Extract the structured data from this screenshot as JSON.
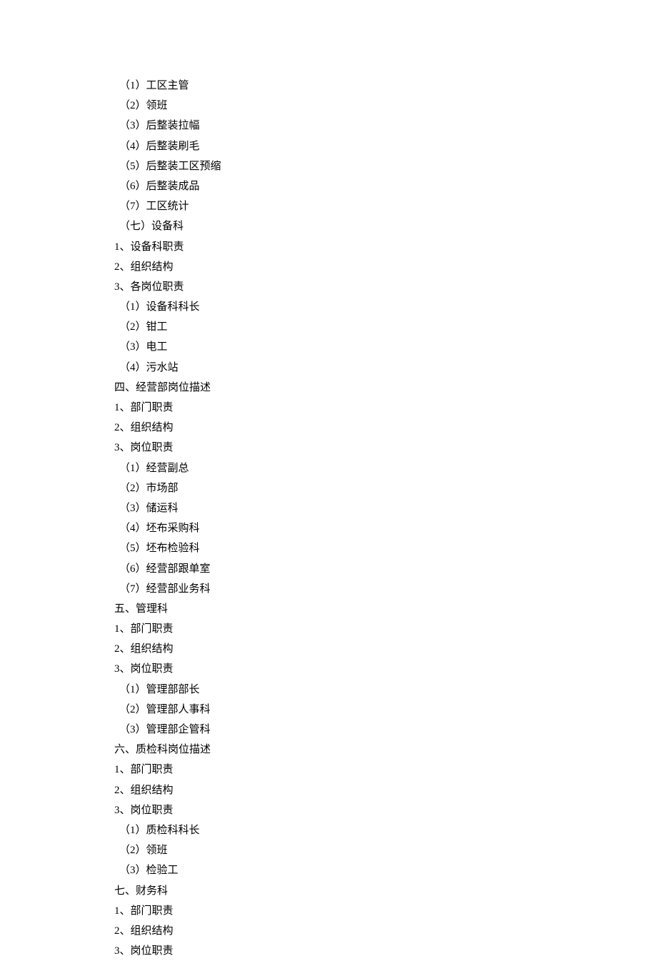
{
  "lines": [
    {
      "indent": 1,
      "text": "（1）工区主管"
    },
    {
      "indent": 1,
      "text": "（2）领班"
    },
    {
      "indent": 1,
      "text": "（3）后整装拉幅"
    },
    {
      "indent": 1,
      "text": "（4）后整装刷毛"
    },
    {
      "indent": 1,
      "text": "（5）后整装工区预缩"
    },
    {
      "indent": 1,
      "text": "（6）后整装成品"
    },
    {
      "indent": 1,
      "text": "（7）工区统计"
    },
    {
      "indent": 1,
      "text": "（七）设备科"
    },
    {
      "indent": 0,
      "text": "1、设备科职责"
    },
    {
      "indent": 0,
      "text": "2、组织结构"
    },
    {
      "indent": 0,
      "text": "3、各岗位职责"
    },
    {
      "indent": 1,
      "text": "（1）设备科科长"
    },
    {
      "indent": 1,
      "text": "（2）钳工"
    },
    {
      "indent": 1,
      "text": "（3）电工"
    },
    {
      "indent": 1,
      "text": "（4）污水站"
    },
    {
      "indent": 0,
      "text": "四、经营部岗位描述"
    },
    {
      "indent": 0,
      "text": "1、部门职责"
    },
    {
      "indent": 0,
      "text": "2、组织结构"
    },
    {
      "indent": 0,
      "text": "3、岗位职责"
    },
    {
      "indent": 1,
      "text": "（1）经营副总"
    },
    {
      "indent": 1,
      "text": "（2）市场部"
    },
    {
      "indent": 1,
      "text": "（3）储运科"
    },
    {
      "indent": 1,
      "text": "（4）坯布采购科"
    },
    {
      "indent": 1,
      "text": "（5）坯布检验科"
    },
    {
      "indent": 1,
      "text": "（6）经营部跟单室"
    },
    {
      "indent": 1,
      "text": "（7）经营部业务科"
    },
    {
      "indent": 0,
      "text": "五、管理科"
    },
    {
      "indent": 0,
      "text": "1、部门职责"
    },
    {
      "indent": 0,
      "text": "2、组织结构"
    },
    {
      "indent": 0,
      "text": "3、岗位职责"
    },
    {
      "indent": 1,
      "text": "（1）管理部部长"
    },
    {
      "indent": 1,
      "text": "（2）管理部人事科"
    },
    {
      "indent": 1,
      "text": "（3）管理部企管科"
    },
    {
      "indent": 0,
      "text": "六、质检科岗位描述"
    },
    {
      "indent": 0,
      "text": "1、部门职责"
    },
    {
      "indent": 0,
      "text": "2、组织结构"
    },
    {
      "indent": 0,
      "text": "3、岗位职责"
    },
    {
      "indent": 1,
      "text": "（1）质检科科长"
    },
    {
      "indent": 1,
      "text": "（2）领班"
    },
    {
      "indent": 1,
      "text": "（3）检验工"
    },
    {
      "indent": 0,
      "text": "七、财务科"
    },
    {
      "indent": 0,
      "text": "1、部门职责"
    },
    {
      "indent": 0,
      "text": "2、组织结构"
    },
    {
      "indent": 0,
      "text": "3、岗位职责"
    }
  ]
}
